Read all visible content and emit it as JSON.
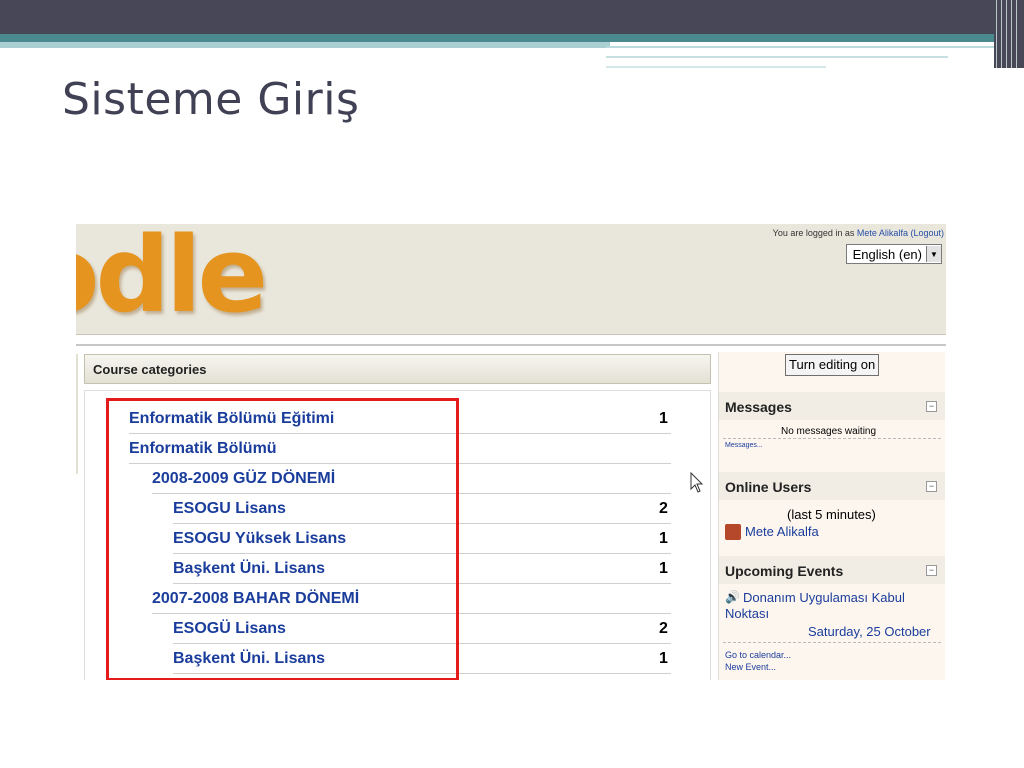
{
  "slide": {
    "title": "Sisteme Giriş"
  },
  "header": {
    "logo_text": "odle",
    "logged_in_prefix": "You are logged in as",
    "user_link": "Mete Alikalfa",
    "logout_link": "(Logout)",
    "language": "English (en)"
  },
  "categories": {
    "title": "Course categories",
    "rows": [
      {
        "name": "Enformatik Bölümü Eğitimi",
        "count": "1"
      },
      {
        "name": "Enformatik Bölümü",
        "count": ""
      },
      {
        "name": "2008-2009 GÜZ DÖNEMİ",
        "count": ""
      },
      {
        "name": "ESOGU Lisans",
        "count": "2"
      },
      {
        "name": "ESOGU Yüksek Lisans",
        "count": "1"
      },
      {
        "name": "Başkent Üni. Lisans",
        "count": "1"
      },
      {
        "name": "2007-2008 BAHAR DÖNEMİ",
        "count": ""
      },
      {
        "name": "ESOGÜ Lisans",
        "count": "2"
      },
      {
        "name": "Başkent Üni. Lisans",
        "count": "1"
      }
    ]
  },
  "sidebar": {
    "edit_button": "Turn editing on",
    "messages": {
      "title": "Messages",
      "status": "No messages waiting",
      "link": "Messages..."
    },
    "online_users": {
      "title": "Online Users",
      "note": "(last 5 minutes)",
      "user": "Mete Alikalfa"
    },
    "upcoming": {
      "title": "Upcoming Events",
      "event": "Donanım Uygulaması Kabul Noktası",
      "date": "Saturday, 25 October",
      "calendar_link": "Go to calendar...",
      "new_event_link": "New Event..."
    }
  },
  "colors": {
    "highlight_border": "#e31b1b",
    "link": "#1a3d9c",
    "title": "#414155",
    "accent_teal": "#4a8a8e"
  }
}
